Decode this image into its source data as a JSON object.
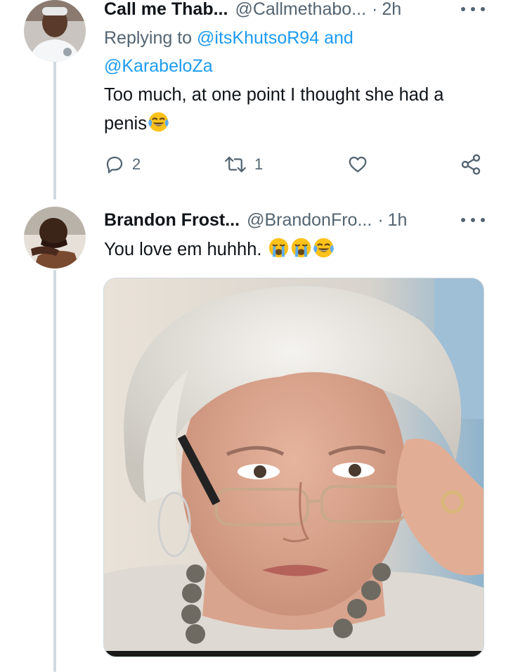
{
  "tweets": [
    {
      "display_name": "Call me Thab...",
      "handle": "@Callmethabo...",
      "separator": "·",
      "time": "2h",
      "replying_prefix": "Replying to",
      "mention_1": "@itsKhutsoR94",
      "conjunction": "and",
      "mention_2": "@KarabeloZa",
      "text": "Too much, at one point I thought she had a penis",
      "text_emoji": "face-with-tears-of-joy",
      "actions": {
        "reply_icon": "reply-icon",
        "reply_count": "2",
        "retweet_icon": "retweet-icon",
        "retweet_count": "1",
        "like_icon": "heart-icon",
        "share_icon": "share-icon"
      }
    },
    {
      "display_name": "Brandon Frost...",
      "handle": "@BrandonFro...",
      "separator": "·",
      "time": "1h",
      "text": "You love em huhhh.",
      "text_emojis": [
        "loudly-crying-face",
        "loudly-crying-face",
        "face-with-tears-of-joy"
      ],
      "media": "photo of a woman with silver hair lowering her glasses"
    }
  ],
  "colors": {
    "text_primary": "#0f1419",
    "text_secondary": "#536471",
    "link": "#1d9bf0",
    "thread_line": "#cfd9de"
  }
}
